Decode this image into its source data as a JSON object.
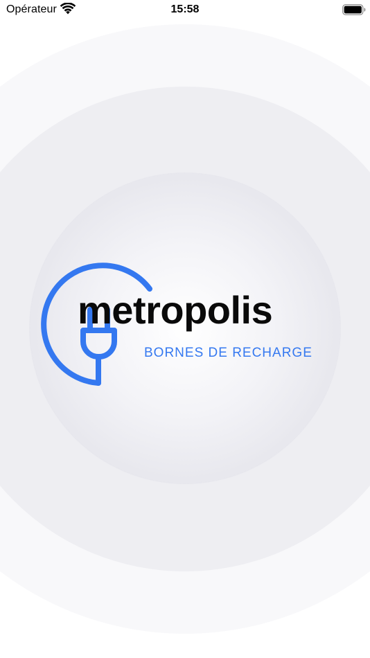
{
  "status_bar": {
    "carrier": "Opérateur",
    "time": "15:58",
    "wifi_icon": "wifi-icon",
    "battery_icon": "battery-full-icon"
  },
  "logo": {
    "wordmark": "metropolis",
    "tagline": "BORNES DE RECHARGE",
    "icon": "plug-icon",
    "accent_color": "#3478f0",
    "text_color": "#0a0a0a"
  },
  "colors": {
    "background": "#ffffff",
    "ring_outer": "#f8f8fa",
    "ring_mid": "#eeeef2",
    "ring_inner": "#dcdce4"
  }
}
